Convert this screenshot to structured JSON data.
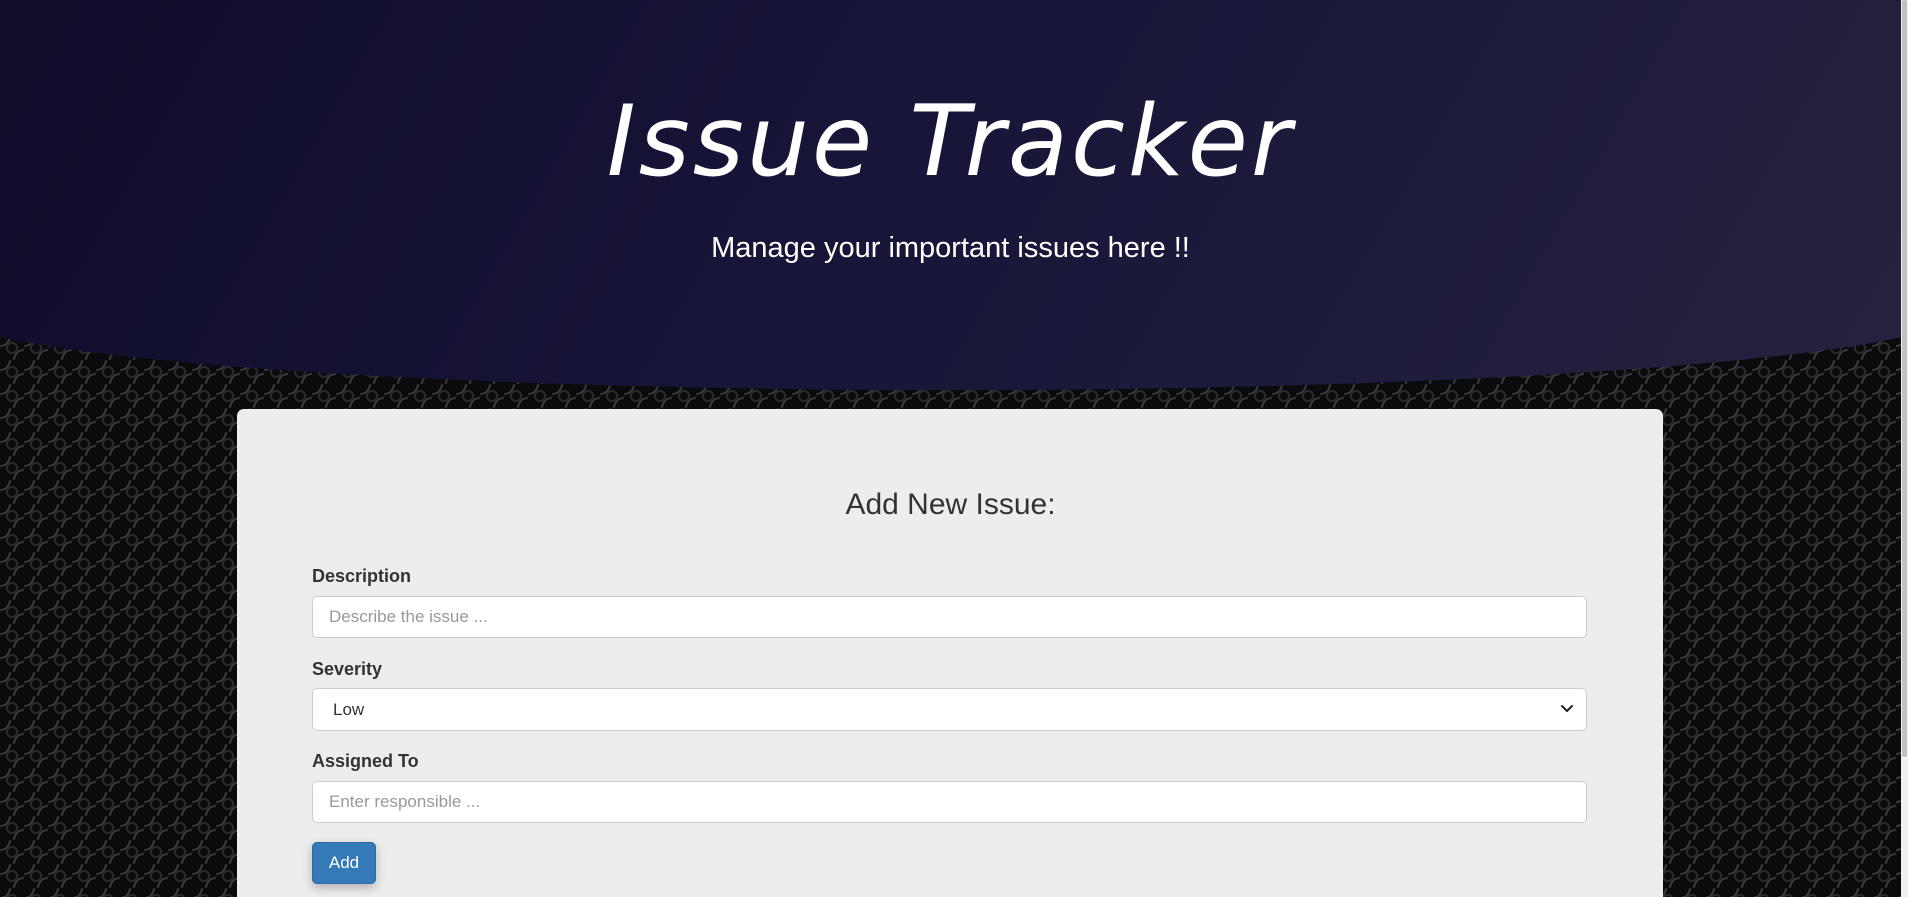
{
  "header": {
    "title": "Issue Tracker",
    "subtitle": "Manage your important issues here !!"
  },
  "form": {
    "heading": "Add New Issue:",
    "description": {
      "label": "Description",
      "placeholder": "Describe the issue ...",
      "value": ""
    },
    "severity": {
      "label": "Severity",
      "selected": "Low"
    },
    "assigned_to": {
      "label": "Assigned To",
      "placeholder": "Enter responsible ...",
      "value": ""
    },
    "add_button_label": "Add"
  },
  "icons": {
    "severity_dropdown": "chevron-down-icon"
  },
  "colors": {
    "header_bg": "#171538",
    "card_bg": "#ededed",
    "button_bg": "#337ab7",
    "text": "#333333"
  }
}
